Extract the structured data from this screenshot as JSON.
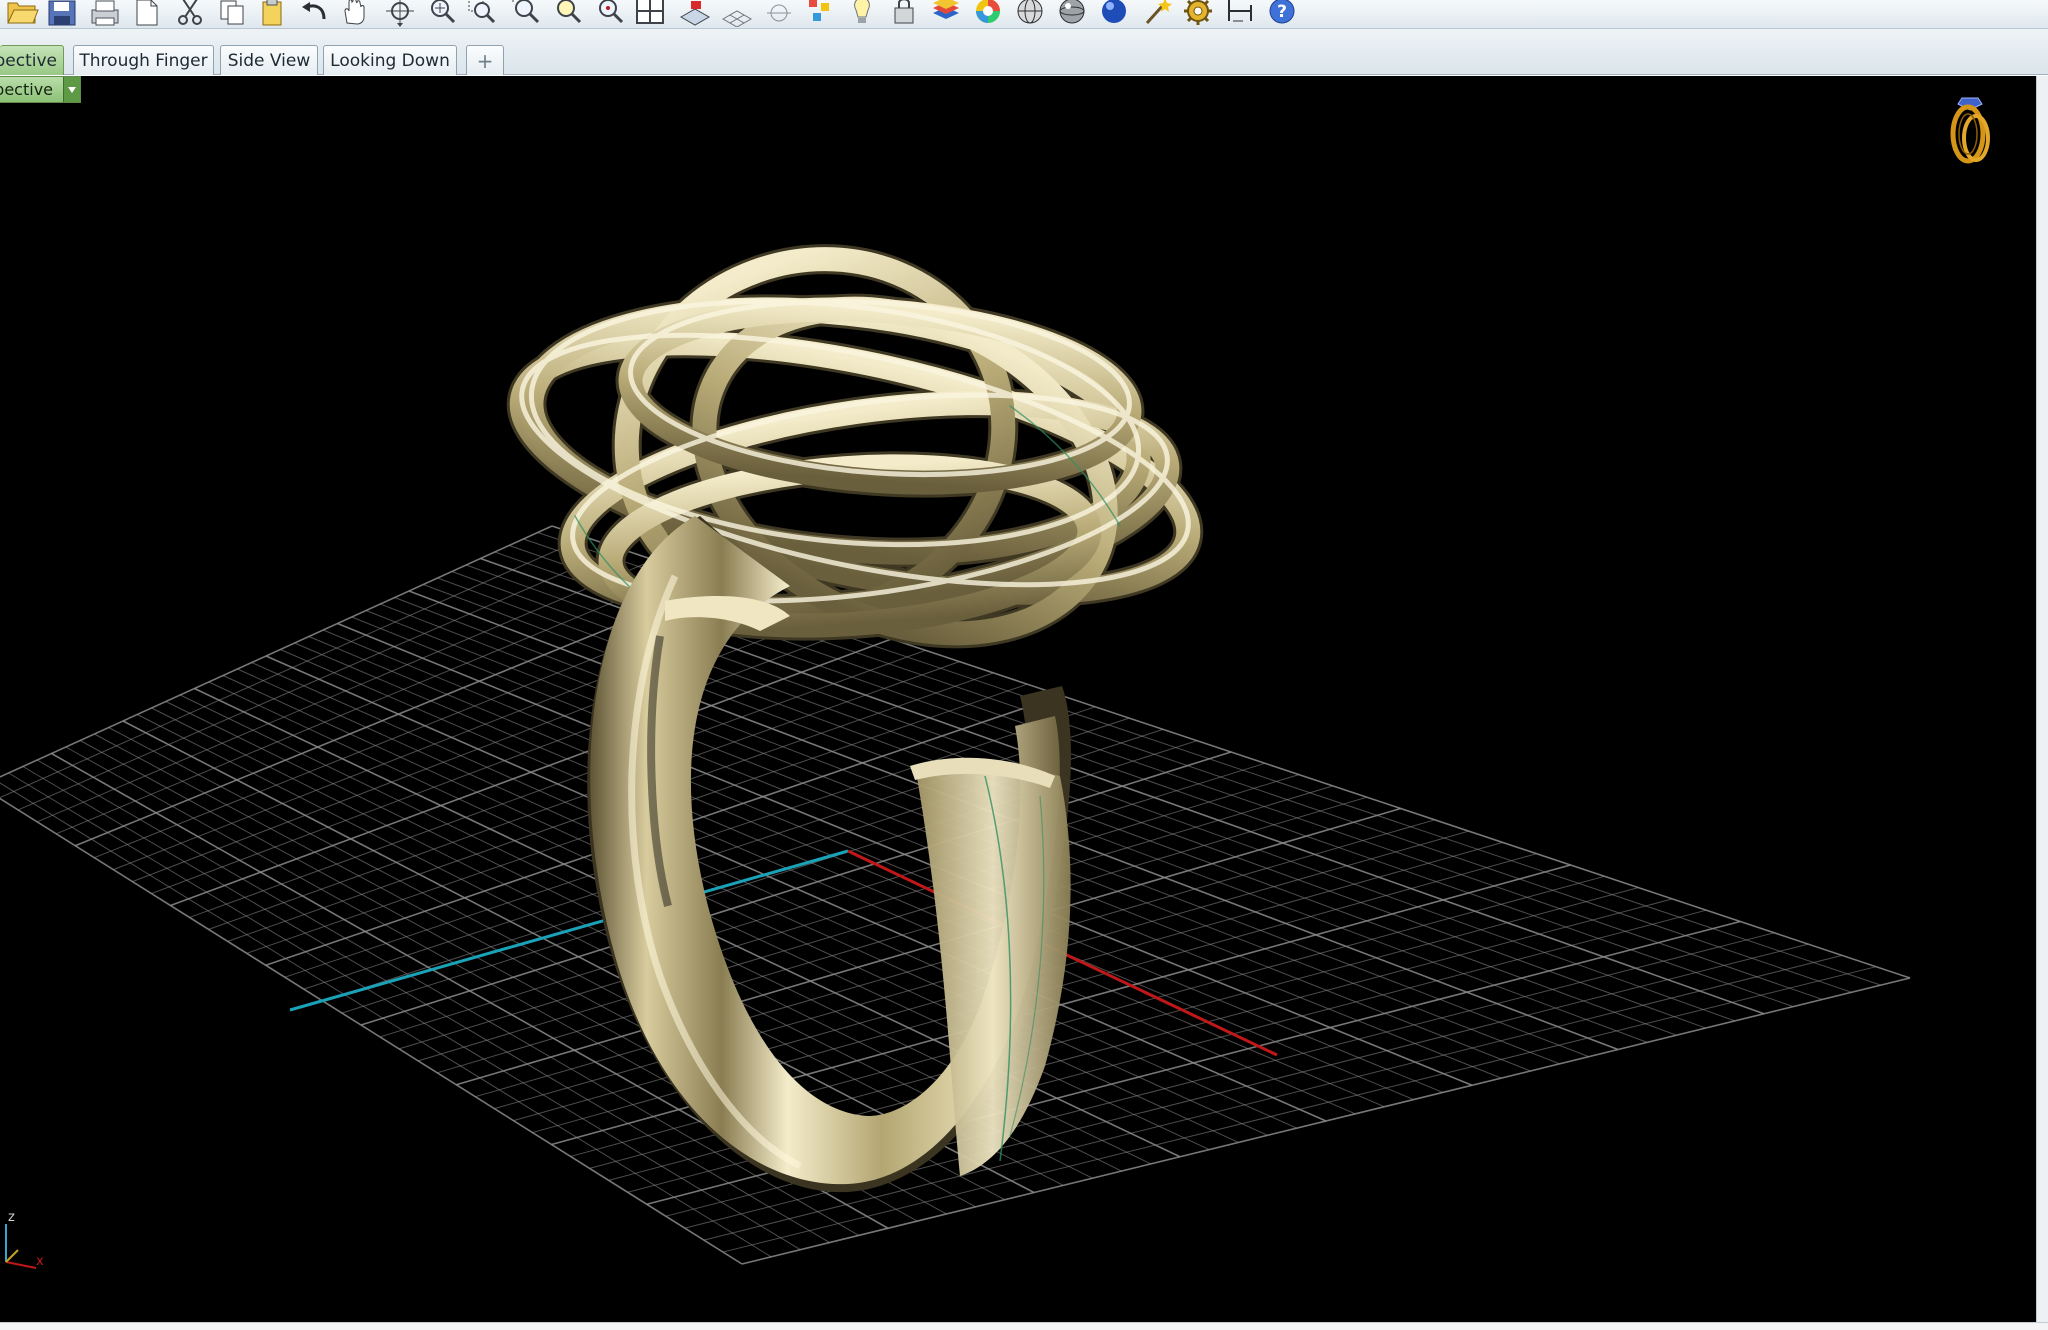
{
  "toolbar": {
    "buttons": [
      {
        "name": "open-icon"
      },
      {
        "name": "save-icon"
      },
      {
        "name": "print-icon"
      },
      {
        "name": "new-page-icon"
      },
      {
        "name": "cut-icon"
      },
      {
        "name": "copy-icon"
      },
      {
        "name": "paste-icon"
      },
      {
        "name": "undo-icon"
      },
      {
        "name": "pan-hand-icon"
      },
      {
        "name": "rotate-view-icon"
      },
      {
        "name": "zoom-dynamic-icon"
      },
      {
        "name": "zoom-window-icon"
      },
      {
        "name": "zoom-extents-icon"
      },
      {
        "name": "zoom-selected-icon"
      },
      {
        "name": "zoom-target-icon"
      },
      {
        "name": "viewport-layout-icon"
      },
      {
        "name": "cplane-icon"
      },
      {
        "name": "grid-snap-icon"
      },
      {
        "name": "object-snap-icon"
      },
      {
        "name": "select-points-icon"
      },
      {
        "name": "light-bulb-icon"
      },
      {
        "name": "lock-icon"
      },
      {
        "name": "layers-icon"
      },
      {
        "name": "color-wheel-icon"
      },
      {
        "name": "wireframe-sphere-icon"
      },
      {
        "name": "shaded-sphere-icon"
      },
      {
        "name": "rendered-sphere-icon"
      },
      {
        "name": "magic-wand-icon"
      },
      {
        "name": "options-gear-icon"
      },
      {
        "name": "dimension-icon"
      },
      {
        "name": "help-icon"
      }
    ]
  },
  "tabs": {
    "items": [
      {
        "label": "pective",
        "active": true
      },
      {
        "label": "Through Finger",
        "active": false
      },
      {
        "label": "Side View",
        "active": false
      },
      {
        "label": "Looking Down",
        "active": false
      },
      {
        "label": "+",
        "active": false
      }
    ]
  },
  "viewport": {
    "title": "pective",
    "background": "#000000",
    "grid_color": "#8c8c8c",
    "x_axis_color": "#c01818",
    "y_axis_color": "#1aa3b8",
    "ring_color": "#cbbd8b"
  },
  "axis_icon": {
    "z": "z",
    "x": "x"
  },
  "colors": {
    "active_tab": "#9ccb87",
    "toolbar": "#e6edf1"
  }
}
